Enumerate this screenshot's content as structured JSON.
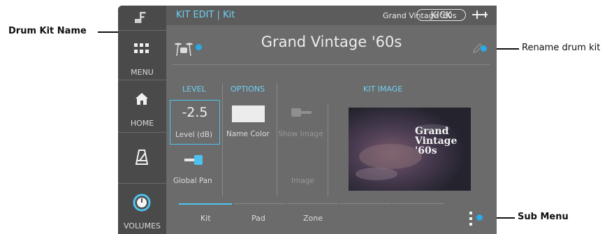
{
  "topbar": {
    "title": "KIT EDIT | Kit",
    "kit_name_small": "Grand Vintage '60s",
    "instrument": "KICK"
  },
  "kit": {
    "name": "Grand Vintage '60s"
  },
  "sidebar": {
    "menu": "MENU",
    "home": "HOME",
    "volumes": "VOLUMES"
  },
  "sections": {
    "level": "LEVEL",
    "options": "OPTIONS",
    "kit_image": "KIT IMAGE"
  },
  "level": {
    "value": "-2.5",
    "label": "Level (dB)",
    "pan_label": "Global Pan"
  },
  "options": {
    "name_color_label": "Name Color",
    "show_image_label": "Show Image",
    "image_label": "Image"
  },
  "kit_image_text": {
    "line1": "Grand",
    "line2": "Vintage",
    "line3": "'60s"
  },
  "tabs": [
    "Kit",
    "Pad",
    "Zone"
  ],
  "annotations": {
    "drum_kit_name": "Drum Kit Name",
    "rename_drum_kit": "Rename drum kit",
    "sub_menu": "Sub Menu"
  },
  "colors": {
    "accent": "#4ec2ef",
    "callout_dot": "#2aa8e8",
    "screen_bg": "#6b6b6b",
    "sidebar_bg": "#4a4a4a"
  }
}
